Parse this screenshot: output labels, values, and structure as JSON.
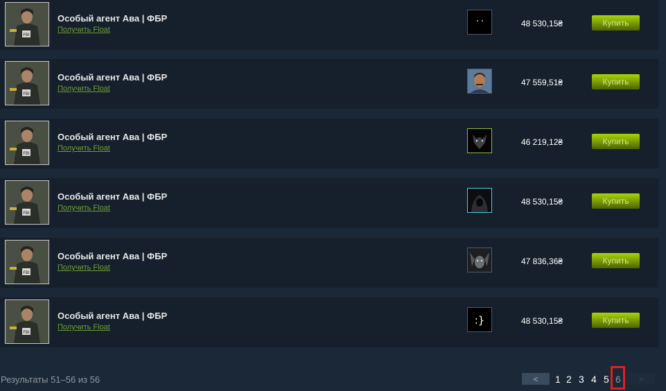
{
  "listings": [
    {
      "title": "Особый агент Ава | ФБР",
      "float_label": "Получить Float",
      "price": "48 530,15₴",
      "buy_label": "Купить",
      "avatar": "dark-eyes"
    },
    {
      "title": "Особый агент Ава | ФБР",
      "float_label": "Получить Float",
      "price": "47 559,51₴",
      "buy_label": "Купить",
      "avatar": "man-photo"
    },
    {
      "title": "Особый агент Ава | ФБР",
      "float_label": "Получить Float",
      "price": "46 219,12₴",
      "buy_label": "Купить",
      "avatar": "wolf"
    },
    {
      "title": "Особый агент Ава | ФБР",
      "float_label": "Получить Float",
      "price": "48 530,15₴",
      "buy_label": "Купить",
      "avatar": "hooded-figure"
    },
    {
      "title": "Особый агент Ава | ФБР",
      "float_label": "Получить Float",
      "price": "47 836,36₴",
      "buy_label": "Купить",
      "avatar": "gargoyle"
    },
    {
      "title": "Особый агент Ава | ФБР",
      "float_label": "Получить Float",
      "price": "48 530,15₴",
      "buy_label": "Купить",
      "avatar": "emoticon"
    }
  ],
  "avatar_glyphs": {
    "emoticon": ":}"
  },
  "pagination": {
    "results_text": "Результаты 51–56 из 56",
    "prev_label": "<",
    "next_label": ">",
    "pages": [
      "1",
      "2",
      "3",
      "4",
      "5",
      "6"
    ],
    "current_page": "6"
  },
  "colors": {
    "background": "#1b2838",
    "row_background": "#16202d",
    "link_green": "#6e9e35",
    "buy_button": "#a4d007",
    "highlight_box": "#e0201f"
  }
}
